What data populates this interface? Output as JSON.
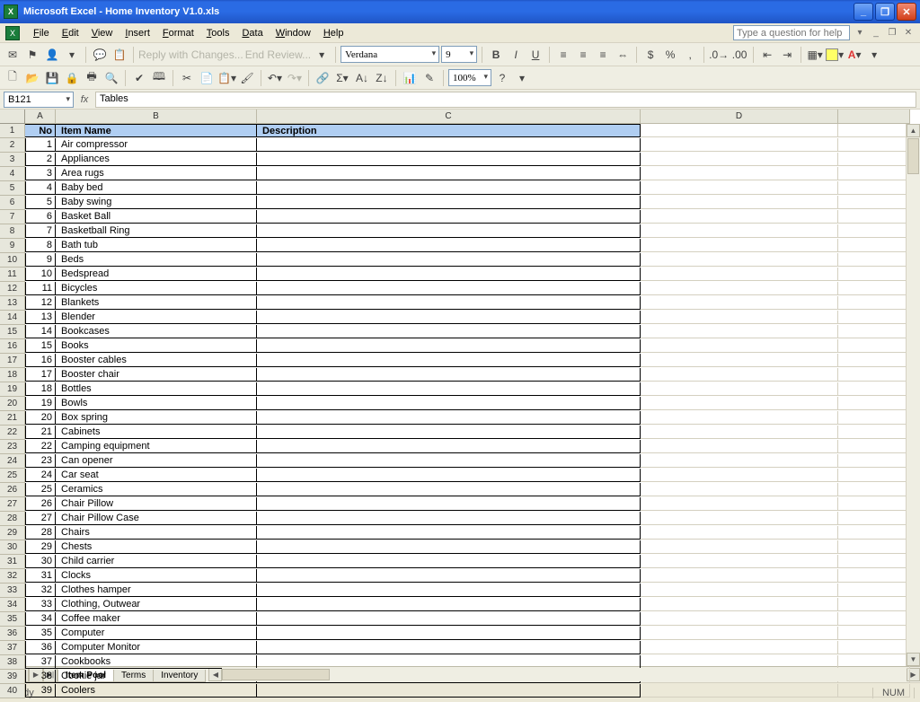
{
  "title": "Microsoft Excel - Home Inventory V1.0.xls",
  "menu": [
    "File",
    "Edit",
    "View",
    "Insert",
    "Format",
    "Tools",
    "Data",
    "Window",
    "Help"
  ],
  "help_placeholder": "Type a question for help",
  "toolbar1": {
    "reply_label": "Reply with Changes...",
    "end_review_label": "End Review..."
  },
  "toolbar1b": {
    "font": "Verdana",
    "size": "9"
  },
  "toolbar2": {
    "zoom": "100%"
  },
  "namebox": "B121",
  "fx": "fx",
  "formula": "Tables",
  "columns": [
    "A",
    "B",
    "C",
    "D"
  ],
  "headers": {
    "A": "No",
    "B": "Item Name",
    "C": "Description"
  },
  "rows": [
    {
      "r": 1
    },
    {
      "r": 2,
      "no": 1,
      "item": "Air compressor"
    },
    {
      "r": 3,
      "no": 2,
      "item": "Appliances"
    },
    {
      "r": 4,
      "no": 3,
      "item": "Area rugs"
    },
    {
      "r": 5,
      "no": 4,
      "item": "Baby bed"
    },
    {
      "r": 6,
      "no": 5,
      "item": "Baby swing"
    },
    {
      "r": 7,
      "no": 6,
      "item": "Basket Ball"
    },
    {
      "r": 8,
      "no": 7,
      "item": "Basketball Ring"
    },
    {
      "r": 9,
      "no": 8,
      "item": "Bath tub"
    },
    {
      "r": 10,
      "no": 9,
      "item": "Beds"
    },
    {
      "r": 11,
      "no": 10,
      "item": "Bedspread"
    },
    {
      "r": 12,
      "no": 11,
      "item": "Bicycles"
    },
    {
      "r": 13,
      "no": 12,
      "item": "Blankets"
    },
    {
      "r": 14,
      "no": 13,
      "item": "Blender"
    },
    {
      "r": 15,
      "no": 14,
      "item": "Bookcases"
    },
    {
      "r": 16,
      "no": 15,
      "item": "Books"
    },
    {
      "r": 17,
      "no": 16,
      "item": "Booster cables"
    },
    {
      "r": 18,
      "no": 17,
      "item": "Booster chair"
    },
    {
      "r": 19,
      "no": 18,
      "item": "Bottles"
    },
    {
      "r": 20,
      "no": 19,
      "item": "Bowls"
    },
    {
      "r": 21,
      "no": 20,
      "item": "Box spring"
    },
    {
      "r": 22,
      "no": 21,
      "item": "Cabinets"
    },
    {
      "r": 23,
      "no": 22,
      "item": "Camping equipment"
    },
    {
      "r": 24,
      "no": 23,
      "item": "Can opener"
    },
    {
      "r": 25,
      "no": 24,
      "item": "Car seat"
    },
    {
      "r": 26,
      "no": 25,
      "item": "Ceramics"
    },
    {
      "r": 27,
      "no": 26,
      "item": "Chair Pillow"
    },
    {
      "r": 28,
      "no": 27,
      "item": "Chair Pillow Case"
    },
    {
      "r": 29,
      "no": 28,
      "item": "Chairs"
    },
    {
      "r": 30,
      "no": 29,
      "item": "Chests"
    },
    {
      "r": 31,
      "no": 30,
      "item": "Child carrier"
    },
    {
      "r": 32,
      "no": 31,
      "item": "Clocks"
    },
    {
      "r": 33,
      "no": 32,
      "item": "Clothes hamper"
    },
    {
      "r": 34,
      "no": 33,
      "item": "Clothing, Outwear"
    },
    {
      "r": 35,
      "no": 34,
      "item": "Coffee maker"
    },
    {
      "r": 36,
      "no": 35,
      "item": "Computer"
    },
    {
      "r": 37,
      "no": 36,
      "item": "Computer Monitor"
    },
    {
      "r": 38,
      "no": 37,
      "item": "Cookbooks"
    },
    {
      "r": 39,
      "no": 38,
      "item": "Cookie jar"
    },
    {
      "r": 40,
      "no": 39,
      "item": "Coolers"
    }
  ],
  "tabs": [
    "Item Pool",
    "Terms",
    "Inventory"
  ],
  "active_tab": 0,
  "status": {
    "ready": "Ready",
    "num": "NUM"
  }
}
